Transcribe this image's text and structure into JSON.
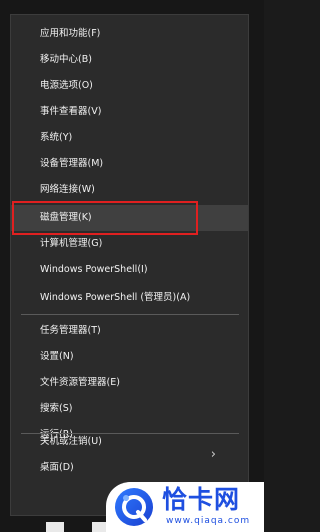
{
  "menu": {
    "items": [
      {
        "label": "应用和功能(F)"
      },
      {
        "label": "移动中心(B)"
      },
      {
        "label": "电源选项(O)"
      },
      {
        "label": "事件查看器(V)"
      },
      {
        "label": "系统(Y)"
      },
      {
        "label": "设备管理器(M)"
      },
      {
        "label": "网络连接(W)"
      },
      {
        "label": "磁盘管理(K)"
      },
      {
        "label": "计算机管理(G)"
      },
      {
        "label": "Windows PowerShell(I)"
      },
      {
        "label": "Windows PowerShell (管理员)(A)"
      },
      {
        "label": "任务管理器(T)"
      },
      {
        "label": "设置(N)"
      },
      {
        "label": "文件资源管理器(E)"
      },
      {
        "label": "搜索(S)"
      },
      {
        "label": "运行(R)"
      },
      {
        "label": "关机或注销(U)"
      },
      {
        "label": "桌面(D)"
      }
    ],
    "highlighted": "磁盘管理(K)",
    "submenu_icon": "chevron-right-icon"
  },
  "watermark": {
    "brand_text": "恰卡网",
    "url_text": "www.qiaqa.com",
    "icon": "logo-q-icon"
  },
  "colors": {
    "menu_bg": "#2b2b2b",
    "hover_bg": "#404040",
    "highlight_border": "#e02020",
    "brand": "#1e4fe0"
  }
}
